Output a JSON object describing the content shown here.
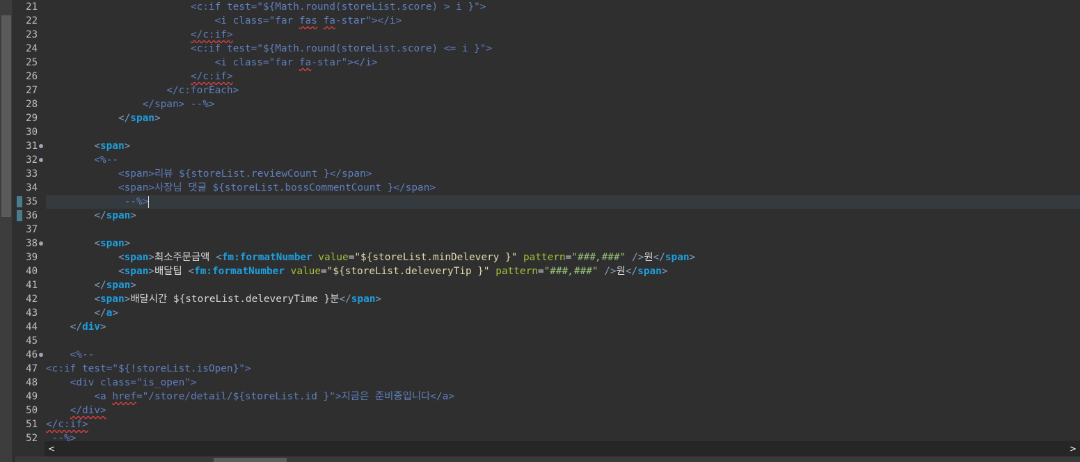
{
  "editor": {
    "current_line": 35,
    "cursor_line": 35,
    "lines": [
      {
        "n": 21,
        "fold": false,
        "mark": false,
        "tokens": [
          [
            "txt",
            "                        "
          ],
          [
            "jsp",
            "<c:if test=\"${Math.round(storeList.score) > i }\">"
          ]
        ]
      },
      {
        "n": 22,
        "fold": false,
        "mark": false,
        "tokens": [
          [
            "txt",
            "                            "
          ],
          [
            "jsp",
            "<i class=\"far "
          ],
          [
            "jsp_sq",
            "fas"
          ],
          [
            "jsp",
            " "
          ],
          [
            "jsp_sq",
            "fa"
          ],
          [
            "jsp",
            "-star\"></i>"
          ]
        ]
      },
      {
        "n": 23,
        "fold": false,
        "mark": false,
        "tokens": [
          [
            "txt",
            "                        "
          ],
          [
            "jsp_sq",
            "</c:if>"
          ]
        ]
      },
      {
        "n": 24,
        "fold": false,
        "mark": false,
        "tokens": [
          [
            "txt",
            "                        "
          ],
          [
            "jsp",
            "<c:if test=\"${Math.round(storeList.score) <= i }\">"
          ]
        ]
      },
      {
        "n": 25,
        "fold": false,
        "mark": false,
        "tokens": [
          [
            "txt",
            "                            "
          ],
          [
            "jsp",
            "<i class=\"far "
          ],
          [
            "jsp_sq",
            "fa"
          ],
          [
            "jsp",
            "-star\"></i>"
          ]
        ]
      },
      {
        "n": 26,
        "fold": false,
        "mark": false,
        "tokens": [
          [
            "txt",
            "                        "
          ],
          [
            "jsp_sq",
            "</c:if>"
          ]
        ]
      },
      {
        "n": 27,
        "fold": false,
        "mark": false,
        "tokens": [
          [
            "txt",
            "                    "
          ],
          [
            "jsp",
            "</c:forEach>"
          ]
        ]
      },
      {
        "n": 28,
        "fold": false,
        "mark": false,
        "tokens": [
          [
            "txt",
            "                "
          ],
          [
            "jsp",
            "</span> --%>"
          ]
        ]
      },
      {
        "n": 29,
        "fold": false,
        "mark": false,
        "tokens": [
          [
            "txt",
            "            "
          ],
          [
            "brk",
            "</"
          ],
          [
            "tag",
            "span"
          ],
          [
            "brk",
            ">"
          ]
        ]
      },
      {
        "n": 30,
        "fold": false,
        "mark": false,
        "tokens": []
      },
      {
        "n": 31,
        "fold": true,
        "mark": false,
        "tokens": [
          [
            "txt",
            "        "
          ],
          [
            "brk",
            "<"
          ],
          [
            "tag",
            "span"
          ],
          [
            "brk",
            ">"
          ]
        ]
      },
      {
        "n": 32,
        "fold": true,
        "mark": false,
        "tokens": [
          [
            "txt",
            "        "
          ],
          [
            "jsp",
            "<%--"
          ]
        ]
      },
      {
        "n": 33,
        "fold": false,
        "mark": false,
        "tokens": [
          [
            "txt",
            "            "
          ],
          [
            "jsp",
            "<span>리뷰 ${storeList.reviewCount }</span>"
          ]
        ]
      },
      {
        "n": 34,
        "fold": false,
        "mark": false,
        "tokens": [
          [
            "txt",
            "            "
          ],
          [
            "jsp",
            "<span>사장님 댓글 ${storeList.bossCommentCount }</span>"
          ]
        ]
      },
      {
        "n": 35,
        "fold": false,
        "mark": true,
        "tokens": [
          [
            "txt",
            "             "
          ],
          [
            "jsp",
            "--%>"
          ]
        ]
      },
      {
        "n": 36,
        "fold": false,
        "mark": true,
        "tokens": [
          [
            "txt",
            "        "
          ],
          [
            "brk",
            "</"
          ],
          [
            "tag",
            "span"
          ],
          [
            "brk",
            ">"
          ]
        ]
      },
      {
        "n": 37,
        "fold": false,
        "mark": false,
        "tokens": []
      },
      {
        "n": 38,
        "fold": true,
        "mark": false,
        "tokens": [
          [
            "txt",
            "        "
          ],
          [
            "brk",
            "<"
          ],
          [
            "tag",
            "span"
          ],
          [
            "brk",
            ">"
          ]
        ]
      },
      {
        "n": 39,
        "fold": false,
        "mark": false,
        "tokens": [
          [
            "txt",
            "            "
          ],
          [
            "brk",
            "<"
          ],
          [
            "tag",
            "span"
          ],
          [
            "brk",
            ">"
          ],
          [
            "txt",
            "최소주문금액 "
          ],
          [
            "brk",
            "<"
          ],
          [
            "tag",
            "fm:formatNumber"
          ],
          [
            "txt",
            " "
          ],
          [
            "attr",
            "value"
          ],
          [
            "txt",
            "="
          ],
          [
            "str",
            "\"${storeList.minDelevery }\""
          ],
          [
            "txt",
            " "
          ],
          [
            "attr",
            "pattern"
          ],
          [
            "txt",
            "="
          ],
          [
            "sstr",
            "\"###,###\""
          ],
          [
            "txt",
            " "
          ],
          [
            "brk",
            "/>"
          ],
          [
            "txt",
            "원"
          ],
          [
            "brk",
            "</"
          ],
          [
            "tag",
            "span"
          ],
          [
            "brk",
            ">"
          ]
        ]
      },
      {
        "n": 40,
        "fold": false,
        "mark": false,
        "tokens": [
          [
            "txt",
            "            "
          ],
          [
            "brk",
            "<"
          ],
          [
            "tag",
            "span"
          ],
          [
            "brk",
            ">"
          ],
          [
            "txt",
            "배달팁 "
          ],
          [
            "brk",
            "<"
          ],
          [
            "tag",
            "fm:formatNumber"
          ],
          [
            "txt",
            " "
          ],
          [
            "attr",
            "value"
          ],
          [
            "txt",
            "="
          ],
          [
            "str",
            "\"${storeList.deleveryTip }\""
          ],
          [
            "txt",
            " "
          ],
          [
            "attr",
            "pattern"
          ],
          [
            "txt",
            "="
          ],
          [
            "sstr",
            "\"###,###\""
          ],
          [
            "txt",
            " "
          ],
          [
            "brk",
            "/>"
          ],
          [
            "txt",
            "원"
          ],
          [
            "brk",
            "</"
          ],
          [
            "tag",
            "span"
          ],
          [
            "brk",
            ">"
          ]
        ]
      },
      {
        "n": 41,
        "fold": false,
        "mark": false,
        "tokens": [
          [
            "txt",
            "        "
          ],
          [
            "brk",
            "</"
          ],
          [
            "tag",
            "span"
          ],
          [
            "brk",
            ">"
          ]
        ]
      },
      {
        "n": 42,
        "fold": false,
        "mark": false,
        "tokens": [
          [
            "txt",
            "        "
          ],
          [
            "brk",
            "<"
          ],
          [
            "tag",
            "span"
          ],
          [
            "brk",
            ">"
          ],
          [
            "txt",
            "배달시간 ${storeList.deleveryTime }분"
          ],
          [
            "brk",
            "</"
          ],
          [
            "tag",
            "span"
          ],
          [
            "brk",
            ">"
          ]
        ]
      },
      {
        "n": 43,
        "fold": false,
        "mark": false,
        "tokens": [
          [
            "txt",
            "        "
          ],
          [
            "brk",
            "</"
          ],
          [
            "tag",
            "a"
          ],
          [
            "brk",
            ">"
          ]
        ]
      },
      {
        "n": 44,
        "fold": false,
        "mark": false,
        "tokens": [
          [
            "txt",
            "    "
          ],
          [
            "brk",
            "</"
          ],
          [
            "tag",
            "div"
          ],
          [
            "brk",
            ">"
          ]
        ]
      },
      {
        "n": 45,
        "fold": false,
        "mark": false,
        "tokens": []
      },
      {
        "n": 46,
        "fold": true,
        "mark": false,
        "tokens": [
          [
            "txt",
            "    "
          ],
          [
            "jsp",
            "<%--"
          ]
        ]
      },
      {
        "n": 47,
        "fold": false,
        "mark": false,
        "tokens": [
          [
            "jsp",
            "<c:if test=\"${!storeList.isOpen}\">"
          ]
        ]
      },
      {
        "n": 48,
        "fold": false,
        "mark": false,
        "tokens": [
          [
            "txt",
            "    "
          ],
          [
            "jsp",
            "<div class=\"is_open\">"
          ]
        ]
      },
      {
        "n": 49,
        "fold": false,
        "mark": false,
        "tokens": [
          [
            "txt",
            "        "
          ],
          [
            "jsp",
            "<a "
          ],
          [
            "jsp_sq",
            "href"
          ],
          [
            "jsp",
            "=\"/store/detail/${storeList.id }\">지금은 준비중입니다</a>"
          ]
        ]
      },
      {
        "n": 50,
        "fold": false,
        "mark": false,
        "tokens": [
          [
            "txt",
            "    "
          ],
          [
            "jsp_sq",
            "</div>"
          ]
        ]
      },
      {
        "n": 51,
        "fold": false,
        "mark": false,
        "tokens": [
          [
            "jsp_sq",
            "</c:if>"
          ]
        ]
      },
      {
        "n": 52,
        "fold": false,
        "mark": false,
        "tokens": [
          [
            "txt",
            " "
          ],
          [
            "jsp",
            "--%>"
          ]
        ]
      }
    ]
  },
  "scrollbar": {
    "left_arrow": "<",
    "right_arrow": ">"
  },
  "icons": {
    "fold_marker": "fold-icon",
    "scroll_left": "chevron-left-icon",
    "scroll_right": "chevron-right-icon"
  }
}
